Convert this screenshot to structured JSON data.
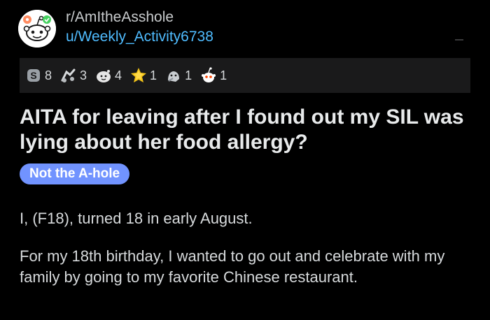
{
  "header": {
    "subreddit": "r/AmItheAsshole",
    "username": "u/Weekly_Activity6738"
  },
  "awards": [
    {
      "icon": "silver-award-icon",
      "count": "8"
    },
    {
      "icon": "helpful-award-icon",
      "count": "3"
    },
    {
      "icon": "wholesome-award-icon",
      "count": "4"
    },
    {
      "icon": "gold-award-icon",
      "count": "1"
    },
    {
      "icon": "hugz-award-icon",
      "count": "1"
    },
    {
      "icon": "alien-award-icon",
      "count": "1"
    }
  ],
  "post": {
    "title": "AITA for leaving after I found out my SIL was lying about her food allergy?",
    "flair": "Not the A-hole",
    "flair_color": "#7193ff",
    "paragraphs": [
      "I, (F18), turned 18 in early August.",
      "For my 18th birthday, I wanted to go out and celebrate with my family by going to my favorite Chinese restaurant."
    ]
  },
  "colors": {
    "background": "#000000",
    "username_link": "#4fbcff",
    "awards_bar": "#1a1a1b"
  }
}
